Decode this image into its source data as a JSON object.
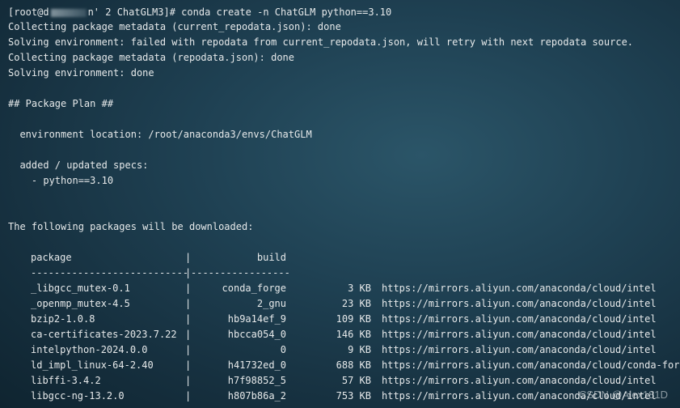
{
  "prompt": {
    "prefix": "[root@d",
    "suffix": "n' 2 ChatGLM3]# ",
    "command": "conda create -n ChatGLM python==3.10"
  },
  "output": [
    "Collecting package metadata (current_repodata.json): done",
    "Solving environment: failed with repodata from current_repodata.json, will retry with next repodata source.",
    "Collecting package metadata (repodata.json): done",
    "Solving environment: done",
    "## Package Plan ##",
    "  environment location: /root/anaconda3/envs/ChatGLM",
    "  added / updated specs:",
    "    - python==3.10",
    "The following packages will be downloaded:"
  ],
  "table": {
    "headers": {
      "package": "package",
      "build": "build"
    },
    "separator_left": "---------------------------",
    "separator_right": "-----------------",
    "rows": [
      {
        "package": "_libgcc_mutex-0.1",
        "build": "conda_forge",
        "size": "3 KB",
        "url": "https://mirrors.aliyun.com/anaconda/cloud/intel"
      },
      {
        "package": "_openmp_mutex-4.5",
        "build": "2_gnu",
        "size": "23 KB",
        "url": "https://mirrors.aliyun.com/anaconda/cloud/intel"
      },
      {
        "package": "bzip2-1.0.8",
        "build": "hb9a14ef_9",
        "size": "109 KB",
        "url": "https://mirrors.aliyun.com/anaconda/cloud/intel"
      },
      {
        "package": "ca-certificates-2023.7.22",
        "build": "hbcca054_0",
        "size": "146 KB",
        "url": "https://mirrors.aliyun.com/anaconda/cloud/intel"
      },
      {
        "package": "intelpython-2024.0.0",
        "build": "0",
        "size": "9 KB",
        "url": "https://mirrors.aliyun.com/anaconda/cloud/intel"
      },
      {
        "package": "ld_impl_linux-64-2.40",
        "build": "h41732ed_0",
        "size": "688 KB",
        "url": "https://mirrors.aliyun.com/anaconda/cloud/conda-forge"
      },
      {
        "package": "libffi-3.4.2",
        "build": "h7f98852_5",
        "size": "57 KB",
        "url": "https://mirrors.aliyun.com/anaconda/cloud/intel"
      },
      {
        "package": "libgcc-ng-13.2.0",
        "build": "h807b86a_2",
        "size": "753 KB",
        "url": "https://mirrors.aliyun.com/anaconda/cloud/intel"
      }
    ]
  },
  "watermark": "CSDN @Alex181D"
}
